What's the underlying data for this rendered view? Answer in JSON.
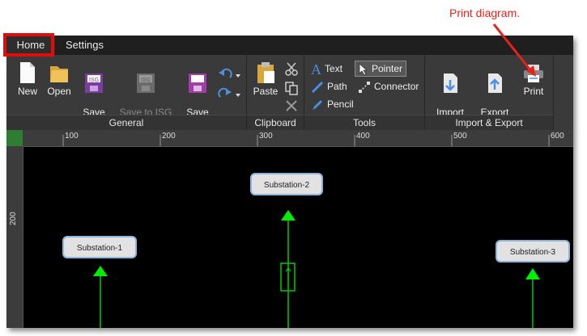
{
  "annotation": {
    "text": "Print diagram."
  },
  "tabs": [
    {
      "label": "Home"
    },
    {
      "label": "Settings"
    }
  ],
  "ribbon": {
    "general": {
      "label": "General",
      "new": "New",
      "open": "Open",
      "save_to_isg": "Save\nto ISG",
      "save_to_isg_new": "Save to ISG\nas new version",
      "save_to_file": "Save\nto File",
      "isg_badge": "ISG"
    },
    "clipboard": {
      "label": "Clipboard",
      "paste": "Paste"
    },
    "tools": {
      "label": "Tools",
      "text": "Text",
      "path": "Path",
      "pencil": "Pencil",
      "pointer": "Pointer",
      "connector": "Connector"
    },
    "import_export": {
      "label": "Import & Export",
      "import": "Import\nfrom File",
      "export": "Export\nto Image",
      "print": "Print"
    }
  },
  "ruler": {
    "h_ticks": [
      "100",
      "200",
      "300",
      "400",
      "500",
      "600"
    ],
    "v_ticks": [
      "200"
    ]
  },
  "canvas": {
    "nodes": [
      {
        "label": "Substation-2"
      },
      {
        "label": "Substation-1"
      },
      {
        "label": "Substation-3"
      }
    ]
  },
  "colors": {
    "accent_red": "#e00d0d",
    "connector_green": "#00cc00",
    "node_border": "#8fb3d9"
  }
}
